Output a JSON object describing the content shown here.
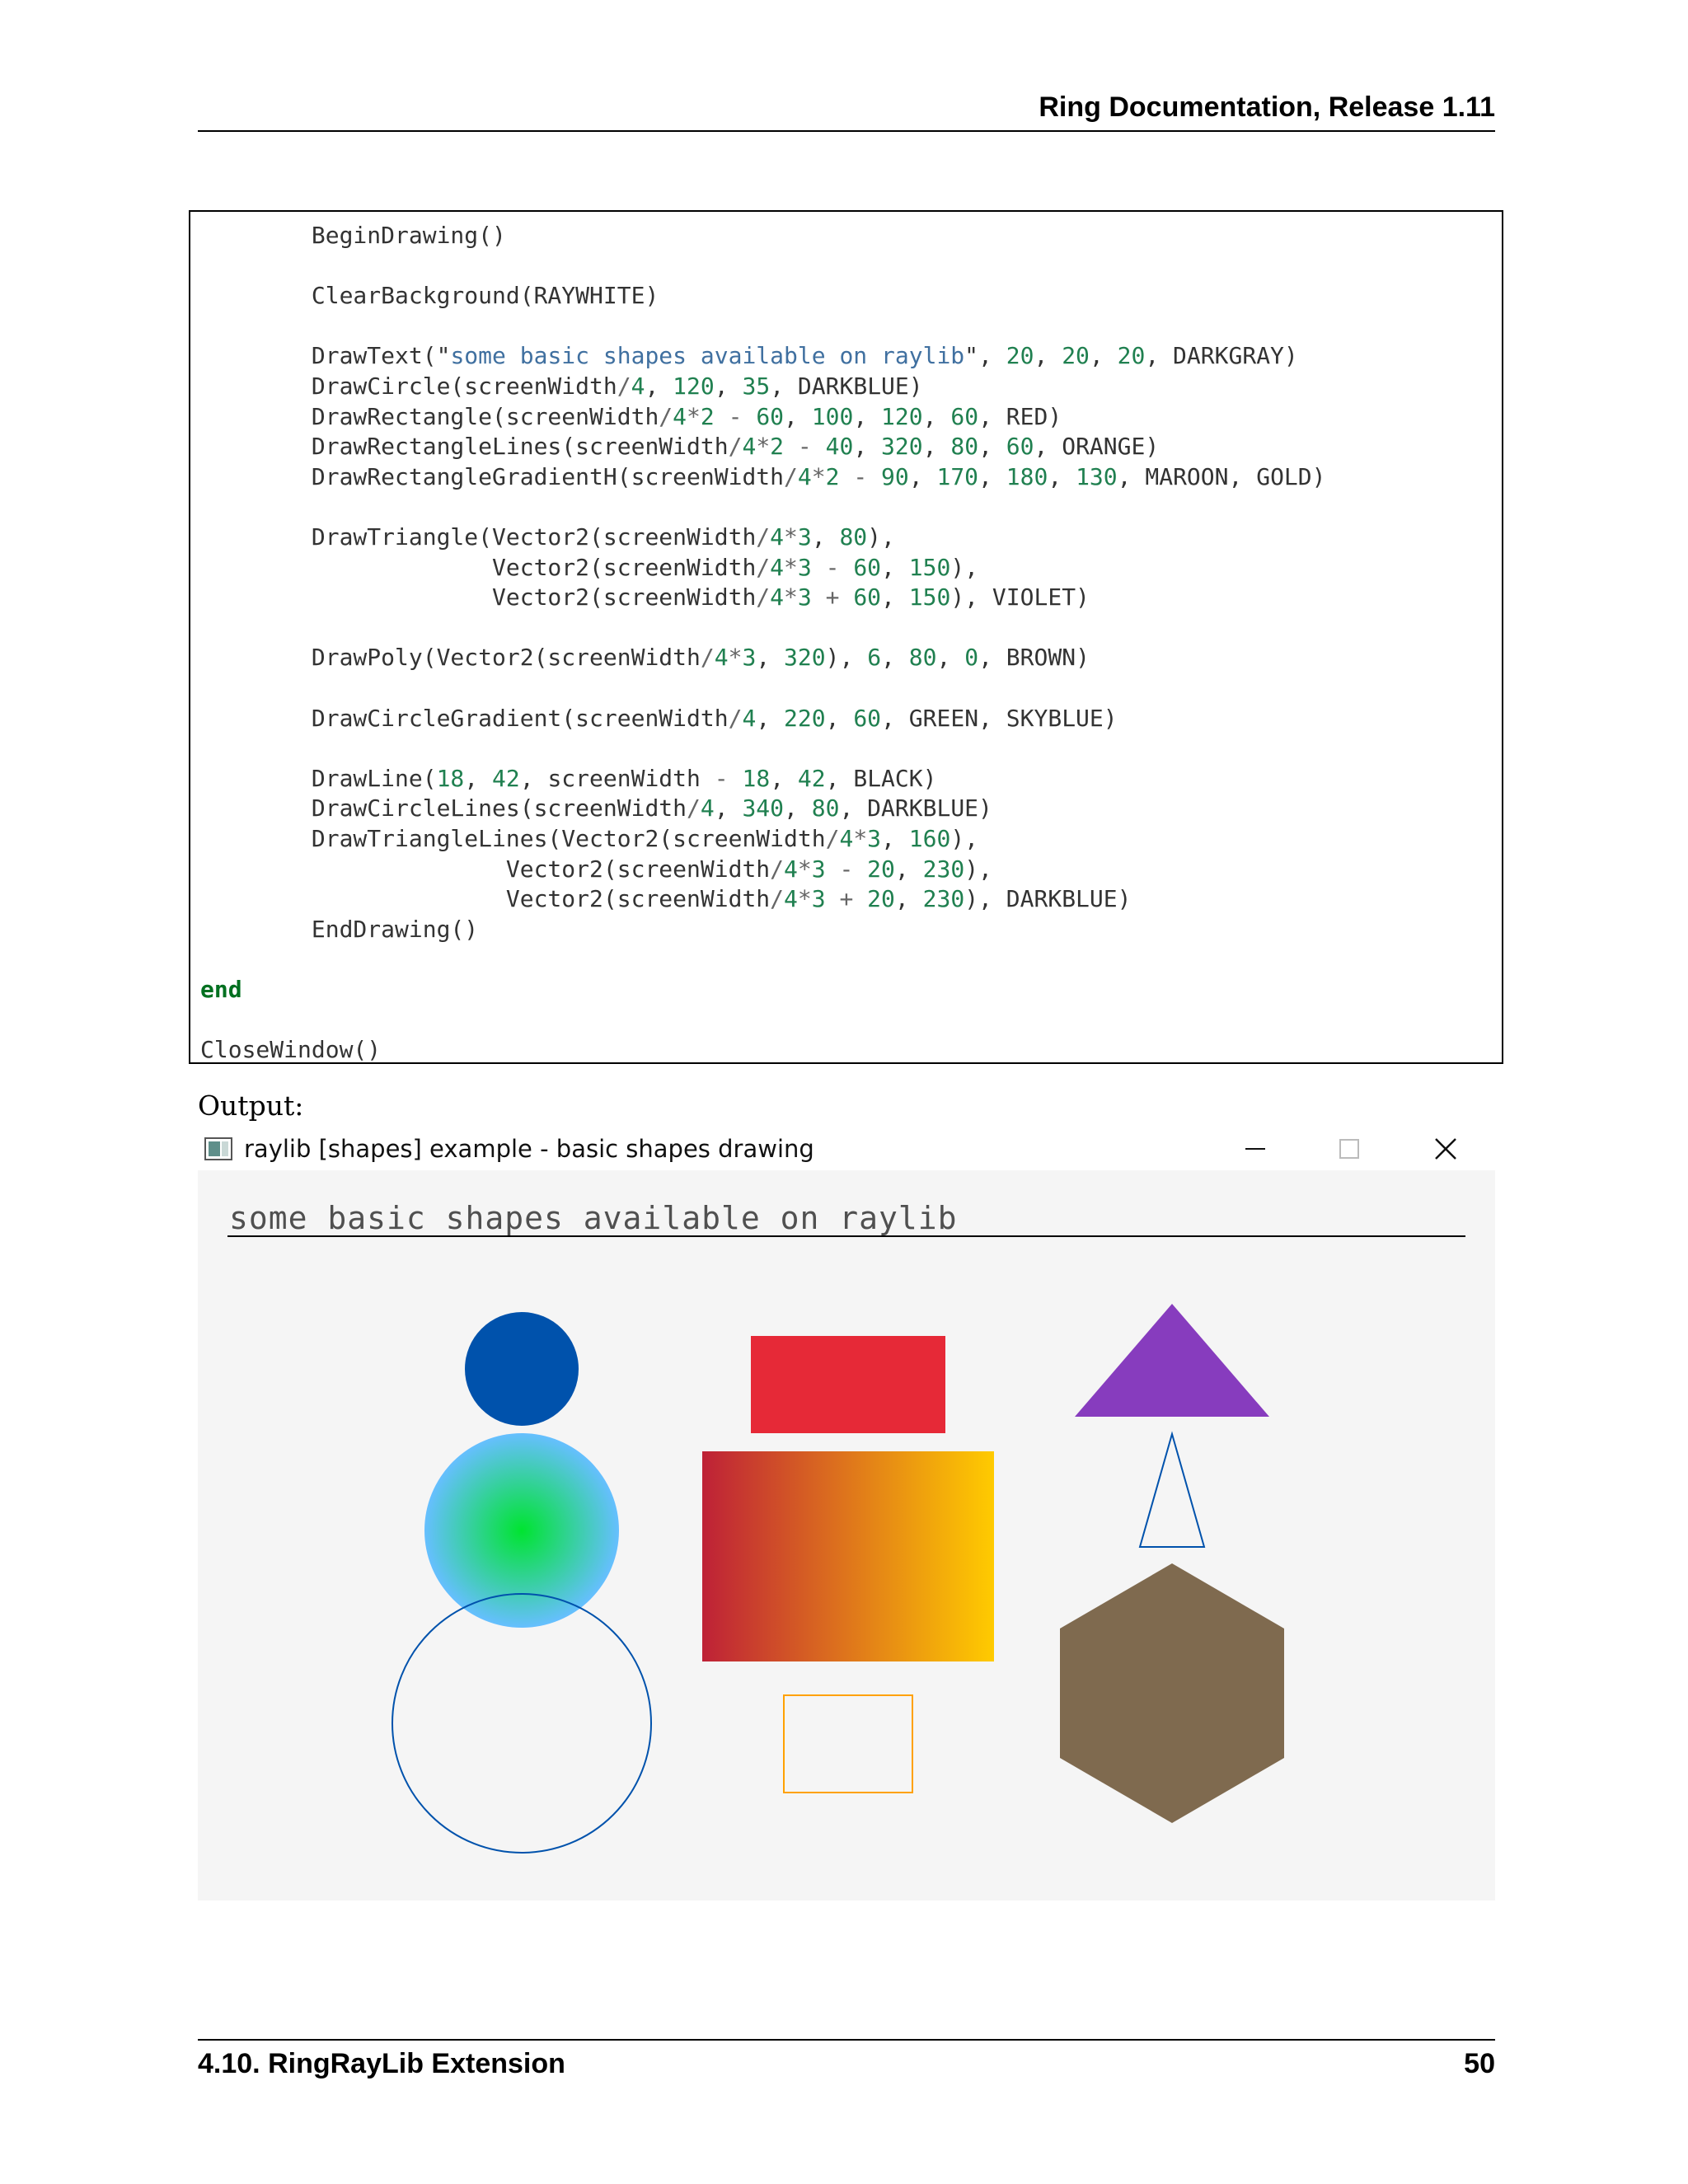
{
  "header": {
    "title": "Ring Documentation, Release 1.11"
  },
  "code": {
    "lines": [
      "        BeginDrawing()",
      "",
      "        ClearBackground(RAYWHITE)",
      "",
      "        DrawText(\"some basic shapes available on raylib\", 20, 20, 20, DARKGRAY)",
      "        DrawCircle(screenWidth/4, 120, 35, DARKBLUE)",
      "        DrawRectangle(screenWidth/4*2 - 60, 100, 120, 60, RED)",
      "        DrawRectangleLines(screenWidth/4*2 - 40, 320, 80, 60, ORANGE)",
      "        DrawRectangleGradientH(screenWidth/4*2 - 90, 170, 180, 130, MAROON, GOLD)",
      "",
      "        DrawTriangle(Vector2(screenWidth/4*3, 80),",
      "                     Vector2(screenWidth/4*3 - 60, 150),",
      "                     Vector2(screenWidth/4*3 + 60, 150), VIOLET)",
      "",
      "        DrawPoly(Vector2(screenWidth/4*3, 320), 6, 80, 0, BROWN)",
      "",
      "        DrawCircleGradient(screenWidth/4, 220, 60, GREEN, SKYBLUE)",
      "",
      "        DrawLine(18, 42, screenWidth - 18, 42, BLACK)",
      "        DrawCircleLines(screenWidth/4, 340, 80, DARKBLUE)",
      "        DrawTriangleLines(Vector2(screenWidth/4*3, 160),",
      "                      Vector2(screenWidth/4*3 - 20, 230),",
      "                      Vector2(screenWidth/4*3 + 20, 230), DARKBLUE)",
      "        EndDrawing()",
      "",
      "end",
      "",
      "CloseWindow()"
    ]
  },
  "output_label": "Output:",
  "window": {
    "title": "raylib [shapes] example - basic shapes drawing",
    "canvas_text": "some basic shapes available on raylib",
    "icons": [
      "app-icon",
      "minimize-icon",
      "maximize-icon",
      "close-icon"
    ],
    "colors": {
      "darkblue": "#0052ac",
      "red": "#e62937",
      "orange": "#ffa100",
      "maroon": "#be2137",
      "gold": "#ffcb00",
      "violet": "#873cbe",
      "brown": "#7f6a4f",
      "green": "#00e430",
      "skyblue": "#66bfff",
      "background": "#f5f5f5"
    }
  },
  "footer": {
    "section": "4.10.  RingRayLib Extension",
    "page": "50"
  }
}
